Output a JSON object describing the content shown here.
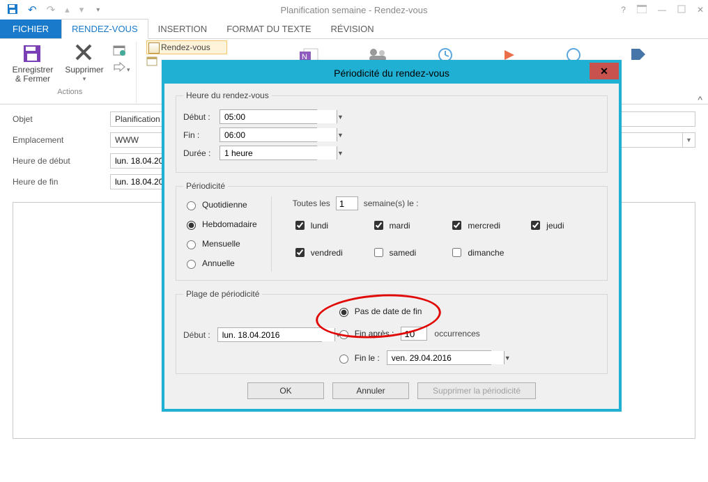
{
  "window": {
    "title": "Planification semaine  -  Rendez-vous"
  },
  "tabs": {
    "file": "FICHIER",
    "rdv": "RENDEZ-VOUS",
    "insertion": "INSERTION",
    "format": "FORMAT DU TEXTE",
    "revision": "RÉVISION"
  },
  "ribbon": {
    "save_close": "Enregistrer & Fermer",
    "delete": "Supprimer",
    "group_actions": "Actions",
    "appointment_tab": "Rendez-vous"
  },
  "form": {
    "subject_label": "Objet",
    "subject_value": "Planification semaine",
    "location_label": "Emplacement",
    "location_value": "WWW",
    "start_label": "Heure de début",
    "start_value": "lun. 18.04.2016",
    "end_label": "Heure de fin",
    "end_value": "lun. 18.04.2016"
  },
  "dialog": {
    "title": "Périodicité du rendez-vous",
    "time_legend": "Heure du rendez-vous",
    "start_lbl": "Début :",
    "start_val": "05:00",
    "end_lbl": "Fin :",
    "end_val": "06:00",
    "dur_lbl": "Durée :",
    "dur_val": "1 heure",
    "period_legend": "Périodicité",
    "radios": {
      "daily": "Quotidienne",
      "weekly": "Hebdomadaire",
      "monthly": "Mensuelle",
      "yearly": "Annuelle"
    },
    "every_prefix": "Toutes les",
    "every_value": "1",
    "every_suffix": "semaine(s) le :",
    "days": {
      "mon": "lundi",
      "tue": "mardi",
      "wed": "mercredi",
      "thu": "jeudi",
      "fri": "vendredi",
      "sat": "samedi",
      "sun": "dimanche"
    },
    "range_legend": "Plage de périodicité",
    "range_start_lbl": "Début :",
    "range_start_val": "lun. 18.04.2016",
    "no_end": "Pas de date de fin",
    "end_after": "Fin après :",
    "occurrences_val": "10",
    "occurrences_lbl": "occurrences",
    "end_on": "Fin le :",
    "end_on_val": "ven. 29.04.2016",
    "ok": "OK",
    "cancel": "Annuler",
    "remove": "Supprimer la périodicité"
  }
}
